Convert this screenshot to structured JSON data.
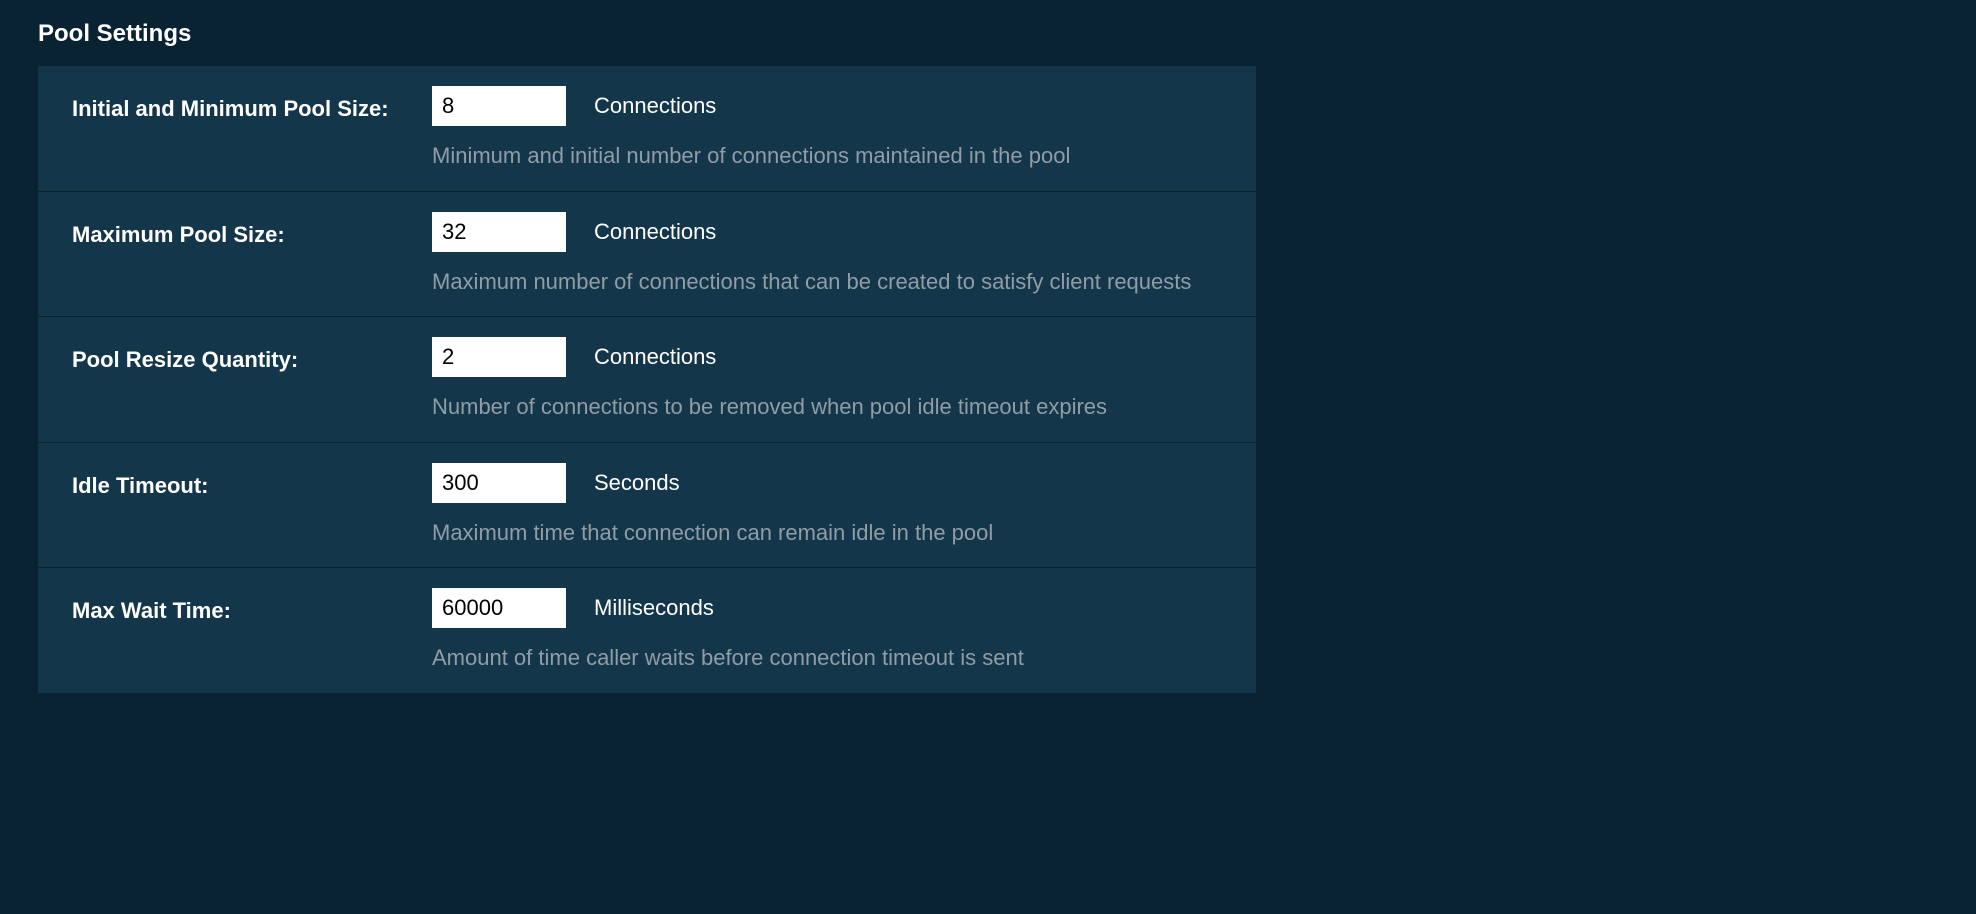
{
  "section": {
    "title": "Pool Settings"
  },
  "settings": {
    "initialPoolSize": {
      "label": "Initial and Minimum Pool Size:",
      "value": "8",
      "unit": "Connections",
      "description": "Minimum and initial number of connections maintained in the pool"
    },
    "maxPoolSize": {
      "label": "Maximum Pool Size:",
      "value": "32",
      "unit": "Connections",
      "description": "Maximum number of connections that can be created to satisfy client requests"
    },
    "poolResizeQuantity": {
      "label": "Pool Resize Quantity:",
      "value": "2",
      "unit": "Connections",
      "description": "Number of connections to be removed when pool idle timeout expires"
    },
    "idleTimeout": {
      "label": "Idle Timeout:",
      "value": "300",
      "unit": "Seconds",
      "description": "Maximum time that connection can remain idle in the pool"
    },
    "maxWaitTime": {
      "label": "Max Wait Time:",
      "value": "60000",
      "unit": "Milliseconds",
      "description": "Amount of time caller waits before connection timeout is sent"
    }
  }
}
